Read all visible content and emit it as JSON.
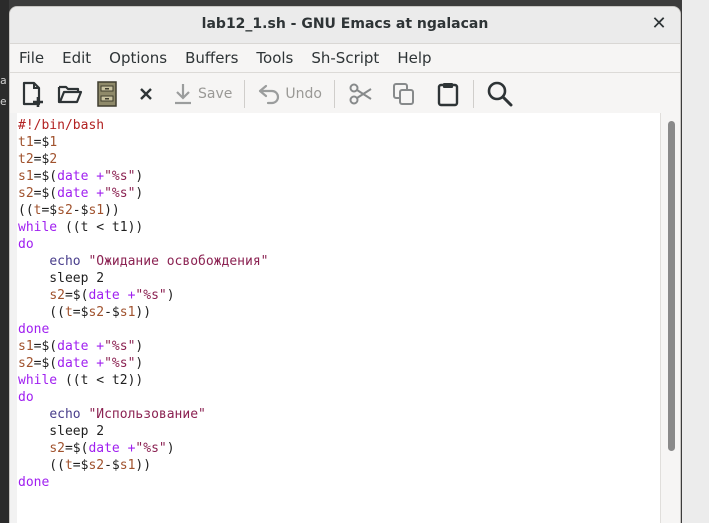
{
  "window": {
    "title": "lab12_1.sh - GNU Emacs at ngalacan",
    "close_glyph": "✕"
  },
  "menubar": {
    "items": [
      "File",
      "Edit",
      "Options",
      "Buffers",
      "Tools",
      "Sh-Script",
      "Help"
    ]
  },
  "toolbar": {
    "new_file": "new-file-icon",
    "open": "folder-open-icon",
    "dired": "file-cabinet-icon",
    "kill": "close-icon",
    "save_label": "Save",
    "undo_label": "Undo",
    "cut": "scissors-icon",
    "copy": "copy-icon",
    "paste": "clipboard-icon",
    "search": "search-icon"
  },
  "desktop": {
    "left_glyph_1": "a",
    "left_glyph_2": "e"
  },
  "code": {
    "lines": [
      "#!/bin/bash",
      "t1=$1",
      "t2=$2",
      "s1=$(date +\"%s\")",
      "s2=$(date +\"%s\")",
      "((t=$s2-$s1))",
      "while ((t < t1))",
      "do",
      "    echo \"Ожидание освобождения\"",
      "    sleep 2",
      "    s2=$(date +\"%s\")",
      "    ((t=$s2-$s1))",
      "done",
      "s1=$(date +\"%s\")",
      "s2=$(date +\"%s\")",
      "while ((t < t2))",
      "do",
      "    echo \"Использование\"",
      "    sleep 2",
      "    s2=$(date +\"%s\")",
      "    ((t=$s2-$s1))",
      "done"
    ]
  },
  "colors": {
    "comment": "#b22222",
    "variable": "#a0522d",
    "keyword": "#a020f0",
    "string": "#8b2252",
    "builtin": "#483d8b"
  }
}
